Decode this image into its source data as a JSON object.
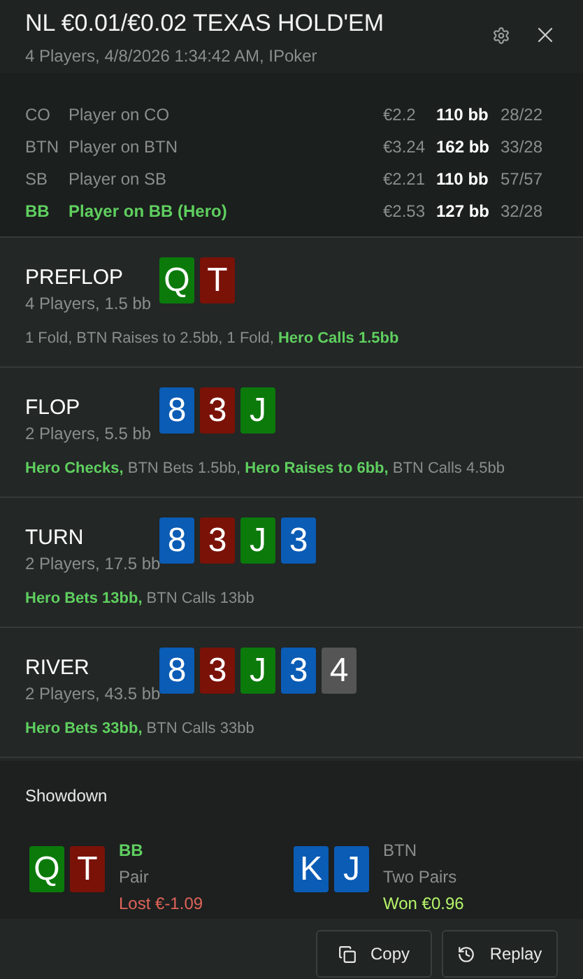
{
  "header": {
    "title": "NL €0.01/€0.02 TEXAS HOLD'EM",
    "subtitle": "4 Players, 4/8/2026 1:34:42 AM, IPoker"
  },
  "players": [
    {
      "position": "CO",
      "name": "Player on CO",
      "stack": "€2.2",
      "bb": "110 bb",
      "stats": "28/22",
      "hero": false
    },
    {
      "position": "BTN",
      "name": "Player on BTN",
      "stack": "€3.24",
      "bb": "162 bb",
      "stats": "33/28",
      "hero": false
    },
    {
      "position": "SB",
      "name": "Player on SB",
      "stack": "€2.21",
      "bb": "110 bb",
      "stats": "57/57",
      "hero": false
    },
    {
      "position": "BB",
      "name": "Player on BB (Hero)",
      "stack": "€2.53",
      "bb": "127 bb",
      "stats": "32/28",
      "hero": true
    }
  ],
  "streets": [
    {
      "name": "PREFLOP",
      "info": "4 Players, 1.5 bb",
      "cards": [
        {
          "rank": "Q",
          "color": "#0b7a0b"
        },
        {
          "rank": "T",
          "color": "#7a1208"
        }
      ],
      "actions": [
        {
          "text": "1 Fold, BTN Raises to 2.5bb, 1 Fold, ",
          "hero": false
        },
        {
          "text": "Hero Calls 1.5bb",
          "hero": true
        }
      ]
    },
    {
      "name": "FLOP",
      "info": "2 Players, 5.5 bb",
      "cards": [
        {
          "rank": "8",
          "color": "#0a5cb5"
        },
        {
          "rank": "3",
          "color": "#7a1208"
        },
        {
          "rank": "J",
          "color": "#0b7a0b"
        }
      ],
      "actions": [
        {
          "text": "Hero Checks,",
          "hero": true
        },
        {
          "text": " BTN Bets 1.5bb, ",
          "hero": false
        },
        {
          "text": "Hero Raises to 6bb,",
          "hero": true
        },
        {
          "text": " BTN Calls 4.5bb",
          "hero": false
        }
      ]
    },
    {
      "name": "TURN",
      "info": "2 Players, 17.5 bb",
      "cards": [
        {
          "rank": "8",
          "color": "#0a5cb5"
        },
        {
          "rank": "3",
          "color": "#7a1208"
        },
        {
          "rank": "J",
          "color": "#0b7a0b"
        },
        {
          "rank": "3",
          "color": "#0a5cb5"
        }
      ],
      "actions": [
        {
          "text": "Hero Bets 13bb,",
          "hero": true
        },
        {
          "text": " BTN Calls 13bb",
          "hero": false
        }
      ]
    },
    {
      "name": "RIVER",
      "info": "2 Players, 43.5 bb",
      "cards": [
        {
          "rank": "8",
          "color": "#0a5cb5"
        },
        {
          "rank": "3",
          "color": "#7a1208"
        },
        {
          "rank": "J",
          "color": "#0b7a0b"
        },
        {
          "rank": "3",
          "color": "#0a5cb5"
        },
        {
          "rank": "4",
          "color": "#555555"
        }
      ],
      "actions": [
        {
          "text": "Hero Bets 33bb,",
          "hero": true
        },
        {
          "text": " BTN Calls 33bb",
          "hero": false
        }
      ]
    }
  ],
  "showdown": {
    "title": "Showdown",
    "hands": [
      {
        "position": "BB",
        "hero": true,
        "cards": [
          {
            "rank": "Q",
            "color": "#0b7a0b"
          },
          {
            "rank": "T",
            "color": "#7a1208"
          }
        ],
        "hand": "Pair",
        "result": "Lost €-1.09",
        "won": false
      },
      {
        "position": "BTN",
        "hero": false,
        "cards": [
          {
            "rank": "K",
            "color": "#0a5cb5"
          },
          {
            "rank": "J",
            "color": "#0a5cb5"
          }
        ],
        "hand": "Two Pairs",
        "result": "Won €0.96",
        "won": true
      }
    ]
  },
  "buttons": [
    {
      "label": "Copy",
      "kind": "copy"
    },
    {
      "label": "Replay",
      "kind": "replay"
    }
  ]
}
